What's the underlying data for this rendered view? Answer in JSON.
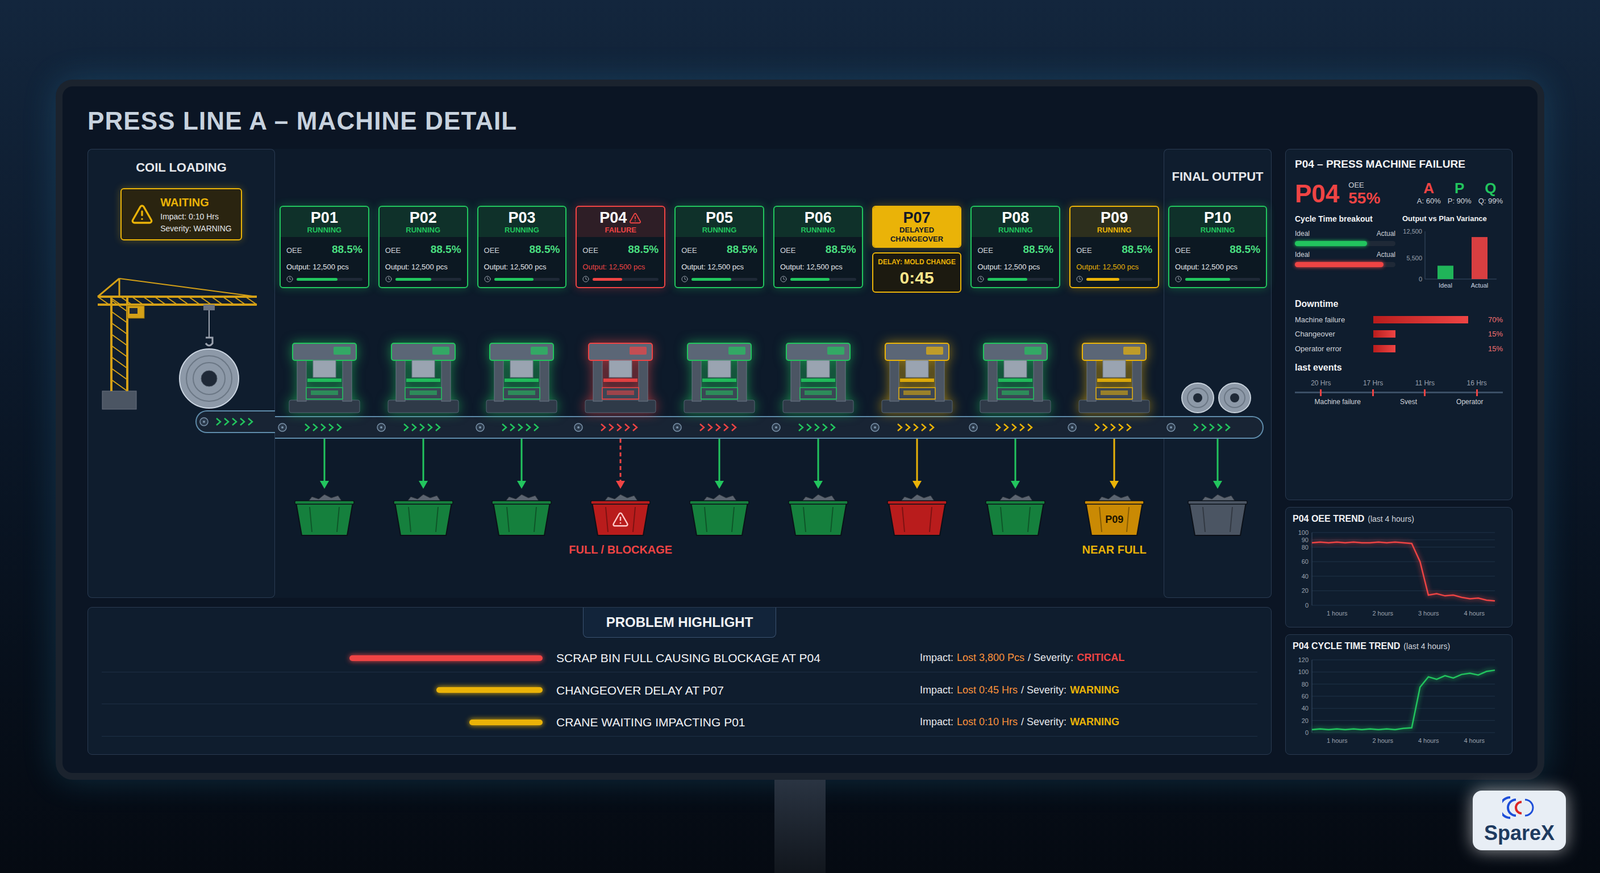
{
  "screen": {
    "title": "PRESS LINE A – MACHINE DETAIL"
  },
  "coil_loading": {
    "title": "COIL LOADING",
    "belt_color": "#22c55e",
    "alert": {
      "status": "WAITING",
      "impact": "Impact: 0:10 Hrs",
      "severity": "Severity: WARNING",
      "color": "#eab308"
    }
  },
  "final_output": {
    "title": "FINAL OUTPUT"
  },
  "stations": [
    {
      "id": "P01",
      "kind": "press",
      "state": "ok",
      "status": "RUNNING",
      "color": "#22c55e",
      "alert": false,
      "oee_label": "OEE",
      "oee": "88.5%",
      "output": "Output: 12,500 pcs",
      "level": 0.62,
      "belt_color": "#22c55e",
      "flow_color": "#22c55e",
      "flow_dashed": false,
      "bin": {
        "color": "#15803d",
        "alert": false
      }
    },
    {
      "id": "P02",
      "kind": "press",
      "state": "ok",
      "status": "RUNNING",
      "color": "#22c55e",
      "alert": false,
      "oee_label": "OEE",
      "oee": "88.5%",
      "output": "Output: 12,500 pcs",
      "level": 0.55,
      "belt_color": "#22c55e",
      "flow_color": "#22c55e",
      "flow_dashed": false,
      "bin": {
        "color": "#15803d",
        "alert": false
      }
    },
    {
      "id": "P03",
      "kind": "press",
      "state": "ok",
      "status": "RUNNING",
      "color": "#22c55e",
      "alert": false,
      "oee_label": "OEE",
      "oee": "88.5%",
      "output": "Output: 12,500 pcs",
      "level": 0.6,
      "belt_color": "#22c55e",
      "flow_color": "#22c55e",
      "flow_dashed": false,
      "bin": {
        "color": "#15803d",
        "alert": false
      }
    },
    {
      "id": "P04",
      "kind": "press",
      "state": "failure",
      "status": "FAILURE",
      "color": "#ef4444",
      "alert": true,
      "oee_label": "OEE",
      "oee": "88.5%",
      "output": "Output: 12,500 pcs",
      "level": 0.45,
      "belt_color": "#ef4444",
      "flow_color": "#ef4444",
      "flow_dashed": true,
      "bin": {
        "color": "#b91c1c",
        "alert": true,
        "label": "FULL / BLOCKAGE"
      }
    },
    {
      "id": "P05",
      "kind": "press",
      "state": "ok",
      "status": "RUNNING",
      "color": "#22c55e",
      "alert": false,
      "oee_label": "OEE",
      "oee": "88.5%",
      "output": "Output: 12,500 pcs",
      "level": 0.6,
      "belt_color": "#ef4444",
      "flow_color": "#22c55e",
      "flow_dashed": false,
      "bin": {
        "color": "#15803d",
        "alert": false
      }
    },
    {
      "id": "P06",
      "kind": "press",
      "state": "ok",
      "status": "RUNNING",
      "color": "#22c55e",
      "alert": false,
      "oee_label": "OEE",
      "oee": "88.5%",
      "output": "Output: 12,500 pcs",
      "level": 0.6,
      "belt_color": "#22c55e",
      "flow_color": "#22c55e",
      "flow_dashed": false,
      "bin": {
        "color": "#15803d",
        "alert": false
      }
    },
    {
      "id": "P07",
      "kind": "changeover",
      "state": "delay",
      "status": "DELAYED CHANGEOVER",
      "color": "#eab308",
      "alert": false,
      "delay": {
        "label": "DELAY: MOLD CHANGE",
        "time": "0:45"
      },
      "belt_color": "#eab308",
      "flow_color": "#eab308",
      "flow_dashed": false,
      "bin": {
        "color": "#b91c1c",
        "alert": false
      }
    },
    {
      "id": "P08",
      "kind": "press",
      "state": "ok",
      "status": "RUNNING",
      "color": "#22c55e",
      "alert": false,
      "oee_label": "OEE",
      "oee": "88.5%",
      "output": "Output: 12,500 pcs",
      "level": 0.6,
      "belt_color": "#eab308",
      "flow_color": "#22c55e",
      "flow_dashed": false,
      "bin": {
        "color": "#15803d",
        "alert": false
      }
    },
    {
      "id": "P09",
      "kind": "press",
      "state": "warning",
      "status": "RUNNING",
      "color": "#eab308",
      "alert": false,
      "oee_label": "OEE",
      "oee": "88.5%",
      "output": "Output: 12,500 pcs",
      "level": 0.5,
      "belt_color": "#eab308",
      "flow_color": "#eab308",
      "flow_dashed": false,
      "bin": {
        "color": "#ca8a04",
        "alert": false,
        "text": "P09",
        "label": "NEAR FULL"
      }
    },
    {
      "id": "P10",
      "kind": "output",
      "state": "ok",
      "status": "RUNNING",
      "color": "#22c55e",
      "alert": false,
      "oee_label": "OEE",
      "oee": "88.5%",
      "output": "Output: 12,500 pcs",
      "level": 0.6,
      "belt_color": "#22c55e",
      "flow_color": "#22c55e",
      "flow_dashed": false,
      "bin": {
        "color": "#4b5563",
        "alert": false
      }
    }
  ],
  "detail": {
    "title": "P04 – PRESS MACHINE FAILURE",
    "machine": "P04",
    "machine_color": "#ef4444",
    "oee_label": "OEE",
    "oee": "55%",
    "apq": [
      {
        "letter": "A",
        "value": "A: 60%",
        "color": "#ef4444"
      },
      {
        "letter": "P",
        "value": "P: 90%",
        "color": "#22c55e"
      },
      {
        "letter": "Q",
        "value": "Q: 99%",
        "color": "#22c55e"
      }
    ],
    "cycle": {
      "title": "Cycle Time breakout",
      "rows": [
        {
          "left": "Ideal",
          "right": "Actual",
          "level": 0.72,
          "color": "#22c55e"
        },
        {
          "left": "Ideal",
          "right": "Actual",
          "level": 0.88,
          "color": "#ef4444"
        }
      ]
    },
    "output": {
      "title": "Output vs Plan Variance",
      "ticks": [
        {
          "label": "12,500",
          "value": 12500
        },
        {
          "label": "5,500",
          "value": 5500
        },
        {
          "label": "0",
          "value": 0
        }
      ],
      "bars": [
        {
          "label": "Ideal",
          "value": 3500,
          "color": "#22c55e"
        },
        {
          "label": "Actual",
          "value": 11000,
          "color": "#ef4444"
        }
      ]
    },
    "downtime": {
      "title": "Downtime",
      "rows": [
        {
          "label": "Machine failure",
          "value": "70%",
          "level": 0.95
        },
        {
          "label": "Changeover",
          "value": "15%",
          "level": 0.22
        },
        {
          "label": "Operator error",
          "value": "15%",
          "level": 0.22
        }
      ]
    },
    "events": {
      "title": "last events",
      "ticks": [
        "20 Hrs",
        "17 Hrs",
        "11 Hrs",
        "16 Hrs"
      ],
      "labels": [
        "Machine failure",
        "Svest",
        "Operator"
      ]
    }
  },
  "oee_trend": {
    "title": "P04 OEE TREND",
    "subtitle": "(last 4 hours)",
    "color": "#ef4444",
    "y_ticks": [
      {
        "label": "100",
        "value": 100
      },
      {
        "label": "90",
        "value": 90
      },
      {
        "label": "80",
        "value": 80
      },
      {
        "label": "60",
        "value": 60
      },
      {
        "label": "40",
        "value": 40
      },
      {
        "label": "20",
        "value": 20
      },
      {
        "label": "0",
        "value": 0
      }
    ],
    "x_ticks": [
      "1 hours",
      "2 hours",
      "3 hours",
      "4 hours"
    ],
    "values": [
      86,
      87,
      86,
      87,
      86,
      87,
      86,
      86,
      87,
      86,
      87,
      86,
      85,
      60,
      14,
      16,
      13,
      14,
      11,
      9,
      10,
      7,
      6
    ]
  },
  "cycle_trend": {
    "title": "P04 CYCLE TIME TREND",
    "subtitle": "(last 4 hours)",
    "color": "#22c55e",
    "y_ticks": [
      {
        "label": "120",
        "value": 120
      },
      {
        "label": "100",
        "value": 100
      },
      {
        "label": "80",
        "value": 80
      },
      {
        "label": "60",
        "value": 60
      },
      {
        "label": "40",
        "value": 40
      },
      {
        "label": "20",
        "value": 20
      },
      {
        "label": "0",
        "value": 0
      }
    ],
    "x_ticks": [
      "1 hours",
      "2 hours",
      "4 hours",
      "4 hours"
    ],
    "values": [
      5,
      6,
      5,
      6,
      5,
      6,
      5,
      6,
      5,
      6,
      5,
      7,
      8,
      75,
      92,
      88,
      94,
      90,
      96,
      98,
      95,
      101,
      103
    ]
  },
  "problems": {
    "title": "PROBLEM HIGHLIGHT",
    "rows": [
      {
        "text": "SCRAP BIN FULL CAUSING BLOCKAGE AT P04",
        "impact_label": "Impact:",
        "impact": "Lost 3,800 Pcs",
        "severity_label": "/ Severity:",
        "severity": "CRITICAL",
        "color": "#ef4444",
        "level": 1
      },
      {
        "text": "CHANGEOVER DELAY AT P07",
        "impact_label": "Impact:",
        "impact": "Lost 0:45 Hrs",
        "severity_label": "/ Severity:",
        "severity": "WARNING",
        "color": "#eab308",
        "level": 0.55
      },
      {
        "text": "CRANE WAITING IMPACTING P01",
        "impact_label": "Impact:",
        "impact": "Lost 0:10 Hrs",
        "severity_label": "/ Severity:",
        "severity": "WARNING",
        "color": "#eab308",
        "level": 0.38
      }
    ]
  },
  "logo": {
    "text": "SpareX"
  }
}
